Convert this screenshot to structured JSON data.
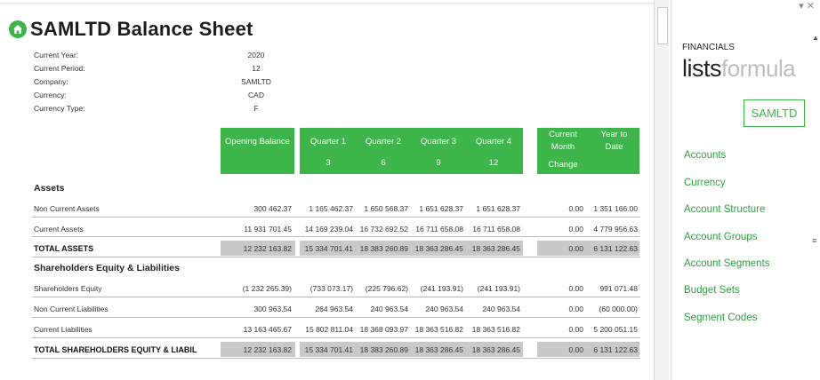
{
  "title": "SAMLTD Balance Sheet",
  "meta": [
    {
      "label": "Current Year:",
      "value": "2020"
    },
    {
      "label": "Current Period:",
      "value": "12"
    },
    {
      "label": "Company:",
      "value": "SAMLTD"
    },
    {
      "label": "Currency:",
      "value": "CAD"
    },
    {
      "label": "Currency Type:",
      "value": "F"
    }
  ],
  "columns": {
    "opening": "Opening Balance",
    "q1": "Quarter 1",
    "q1_num": "3",
    "q2": "Quarter 2",
    "q2_num": "6",
    "q3": "Quarter 3",
    "q3_num": "9",
    "q4": "Quarter 4",
    "q4_num": "12",
    "cmc_1": "Current",
    "cmc_2": "Month",
    "cmc_3": "Change",
    "ytd_1": "Year to",
    "ytd_2": "Date"
  },
  "sections": {
    "assets": "Assets",
    "equity_liab": "Shareholders Equity & Liabilities"
  },
  "rows": [
    {
      "label": "Non Current Assets",
      "values": [
        "300 462.37",
        "1 165 462.37",
        "1 650 568.37",
        "1 651 628.37",
        "1 651 628.37",
        "0.00",
        "1 351 166.00"
      ]
    },
    {
      "label": "Current Assets",
      "values": [
        "11 931 701.45",
        "14 169 239.04",
        "16 732 692.52",
        "16 711 658.08",
        "16 711 658.08",
        "0.00",
        "4 779 956.63"
      ]
    },
    {
      "label": "TOTAL ASSETS",
      "values": [
        "12 232 163.82",
        "15 334 701.41",
        "18 383 260.89",
        "18 363 286.45",
        "18 363 286.45",
        "0.00",
        "6 131 122.63"
      ]
    },
    {
      "label": "Shareholders Equity",
      "values": [
        "(1 232 265.39)",
        "(733 073.17)",
        "(225 796.62)",
        "(241 193.91)",
        "(241 193.91)",
        "0.00",
        "991 071.48"
      ]
    },
    {
      "label": "Non Current Liabilities",
      "values": [
        "300 963.54",
        "264 963.54",
        "240 963.54",
        "240 963.54",
        "240 963.54",
        "0.00",
        "(60 000.00)"
      ]
    },
    {
      "label": "Current Liabilities",
      "values": [
        "13 163 465.67",
        "15 802 811.04",
        "18 368 093.97",
        "18 363 516.82",
        "18 363 516.82",
        "0.00",
        "5 200 051.15"
      ]
    },
    {
      "label": "TOTAL SHAREHOLDERS EQUITY & LIABIL",
      "values": [
        "12 232 163.82",
        "15 334 701.41",
        "18 383 260.89",
        "18 363 286.45",
        "18 363 286.45",
        "0.00",
        "6 131 122.63"
      ]
    }
  ],
  "pane": {
    "controls": "▾ ✕",
    "financials": "FINANCIALS",
    "lists": "lists",
    "formula": "formula",
    "company_button": "SAMLTD",
    "nav": [
      "Accounts",
      "Currency",
      "Account Structure",
      "Account Groups",
      "Account Segments",
      "Budget Sets",
      "Segment Codes"
    ]
  },
  "colors": {
    "accent": "#3db54a",
    "link": "#2e9e3e",
    "total_fill": "#c9c9c9"
  },
  "icons": {
    "home": "home-icon"
  }
}
